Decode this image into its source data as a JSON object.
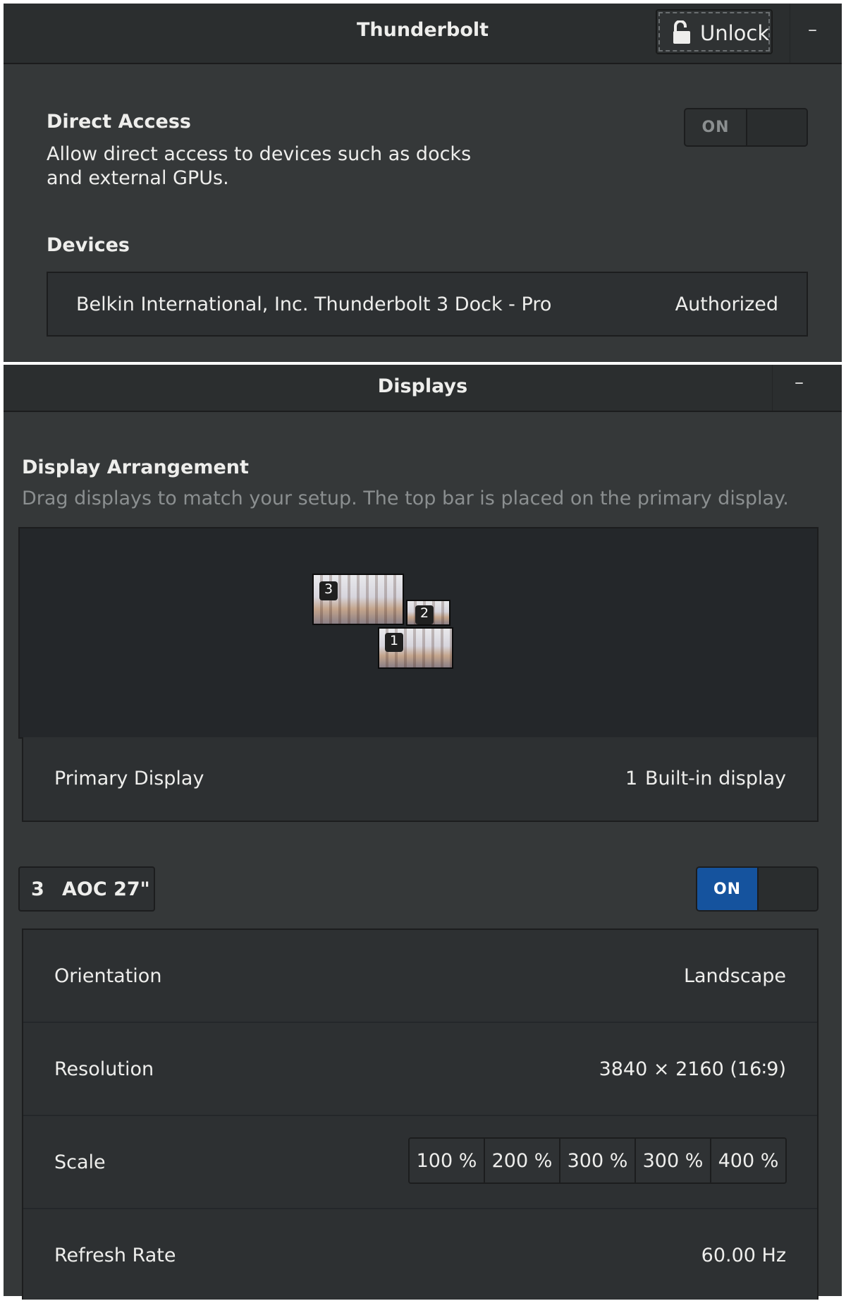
{
  "thunderbolt": {
    "title": "Thunderbolt",
    "unlock_label": "Unlock",
    "minimize_label": "–",
    "direct_access": {
      "title": "Direct Access",
      "description_line1": "Allow direct access to devices such as docks",
      "description_line2": "and external GPUs.",
      "switch_label": "ON",
      "switch_on": false
    },
    "devices": {
      "title": "Devices",
      "items": [
        {
          "name": "Belkin International, Inc. Thunderbolt 3 Dock - Pro",
          "status": "Authorized"
        }
      ]
    }
  },
  "displays": {
    "title": "Displays",
    "minimize_label": "–",
    "arrangement": {
      "title": "Display Arrangement",
      "description": "Drag displays to match your setup. The top bar is placed on the primary display.",
      "monitor_numbers": [
        "3",
        "2",
        "1"
      ]
    },
    "primary": {
      "label": "Primary Display",
      "number": "1",
      "name": "Built-in display"
    },
    "monitor": {
      "number": "3",
      "name": "AOC 27\"",
      "switch_label": "ON",
      "switch_on": true
    },
    "settings": {
      "orientation_label": "Orientation",
      "orientation_value": "Landscape",
      "resolution_label": "Resolution",
      "resolution_value": "3840 × 2160 (16∶9)",
      "scale_label": "Scale",
      "scale_options": [
        "100 %",
        "200 %",
        "300 %",
        "300 %",
        "400 %"
      ],
      "refresh_label": "Refresh Rate",
      "refresh_value": "60.00 Hz"
    }
  },
  "colors": {
    "panel_bg": "#353839",
    "headerbar_bg": "#2b2e2f",
    "list_bg": "#2d3032",
    "accent_blue": "#15539e",
    "text": "#eeeeec",
    "muted_text": "#8b8f90"
  },
  "icons": {
    "lock": "open-padlock-icon",
    "minimize": "minimize-icon"
  }
}
